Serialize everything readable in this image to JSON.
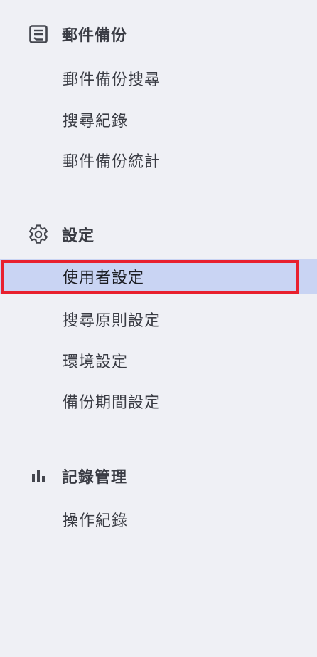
{
  "sections": [
    {
      "title": "郵件備份",
      "icon": "document-list-icon",
      "items": [
        "郵件備份搜尋",
        "搜尋紀錄",
        "郵件備份統計"
      ]
    },
    {
      "title": "設定",
      "icon": "gear-icon",
      "items": [
        "使用者設定",
        "搜尋原則設定",
        "環境設定",
        "備份期間設定"
      ]
    },
    {
      "title": "記錄管理",
      "icon": "bar-chart-icon",
      "items": [
        "操作紀錄"
      ]
    }
  ],
  "active_item": "使用者設定",
  "colors": {
    "background": "#eff0f5",
    "active_background": "#c9d4f3",
    "highlight_border": "#e8202e",
    "text": "#3a3c44"
  }
}
